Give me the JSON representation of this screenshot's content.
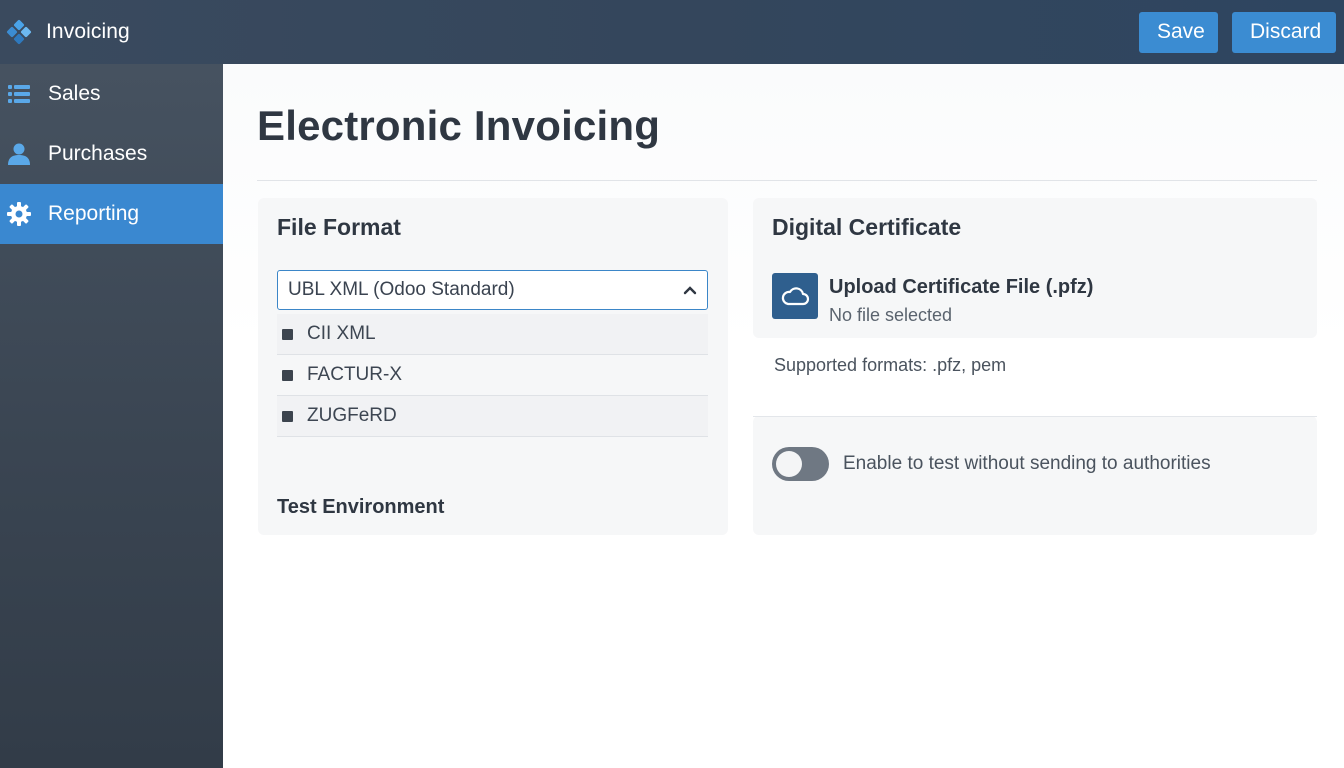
{
  "app": {
    "title": "Invoicing"
  },
  "toolbar": {
    "save_label": "Save",
    "discard_label": "Discard"
  },
  "sidebar": {
    "items": [
      {
        "label": "Sales",
        "icon": "list-icon",
        "active": false
      },
      {
        "label": "Purchases",
        "icon": "user-icon",
        "active": false
      },
      {
        "label": "Reporting",
        "icon": "gear-icon",
        "active": true
      }
    ]
  },
  "page": {
    "title": "Electronic Invoicing"
  },
  "file_format": {
    "title": "File Format",
    "selected": "UBL XML (Odoo Standard)",
    "options": [
      "CII XML",
      "FACTUR-X",
      "ZUGFeRD"
    ]
  },
  "test_environment": {
    "title": "Test Environment",
    "toggle_label": "Enable to test without sending to authorities",
    "enabled": false
  },
  "certificate": {
    "title": "Digital Certificate",
    "upload_label": "Upload Certificate File (.pfz)",
    "status": "No file selected",
    "supported": "Supported formats: .pfz, pem",
    "icon": "cloud-upload-icon"
  },
  "colors": {
    "accent": "#3a88d0",
    "topbar": "#34465c",
    "sidebar": "#3e4956"
  }
}
